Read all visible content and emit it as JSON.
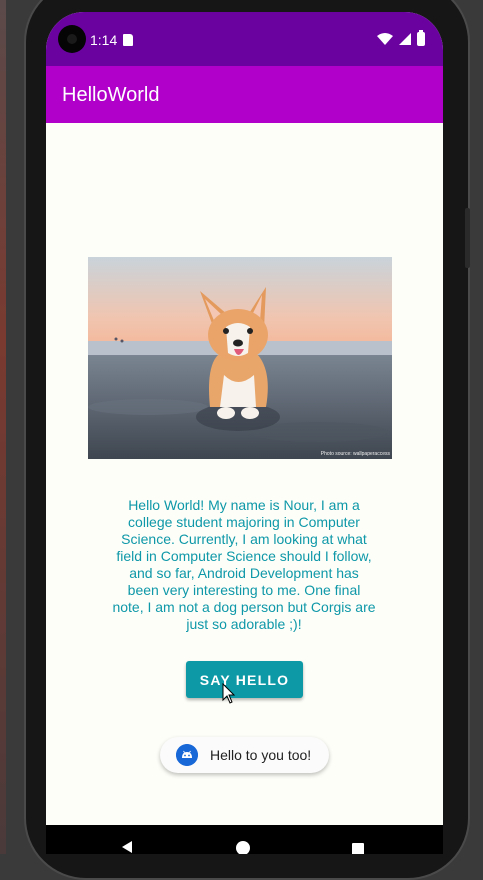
{
  "status_bar": {
    "time": "1:14",
    "icons": [
      "camera-cutout",
      "sd-card-icon",
      "wifi-icon",
      "signal-icon",
      "battery-icon"
    ]
  },
  "app_bar": {
    "title": "HelloWorld"
  },
  "main": {
    "image": {
      "name": "corgi-on-beach-photo",
      "credit": "Photo source: wallpaperaccess"
    },
    "bio": "Hello World! My name is Nour, I am a college student majoring in Computer Science. Currently, I am looking at what field in Computer Science should I follow, and so far, Android Development has been very interesting to me. One final note, I am not a dog person but Corgis are just so adorable ;)!",
    "button_label": "SAY HELLO"
  },
  "toast": {
    "message": "Hello to you too!",
    "icon": "android-icon"
  },
  "nav_bar": {
    "icons": [
      "back-icon",
      "home-icon",
      "recents-icon"
    ]
  },
  "colors": {
    "status_bar": "#6a02a0",
    "app_bar": "#b000c9",
    "accent_text": "#0e98a8",
    "button": "#0d9aa6",
    "background": "#fefef9"
  }
}
